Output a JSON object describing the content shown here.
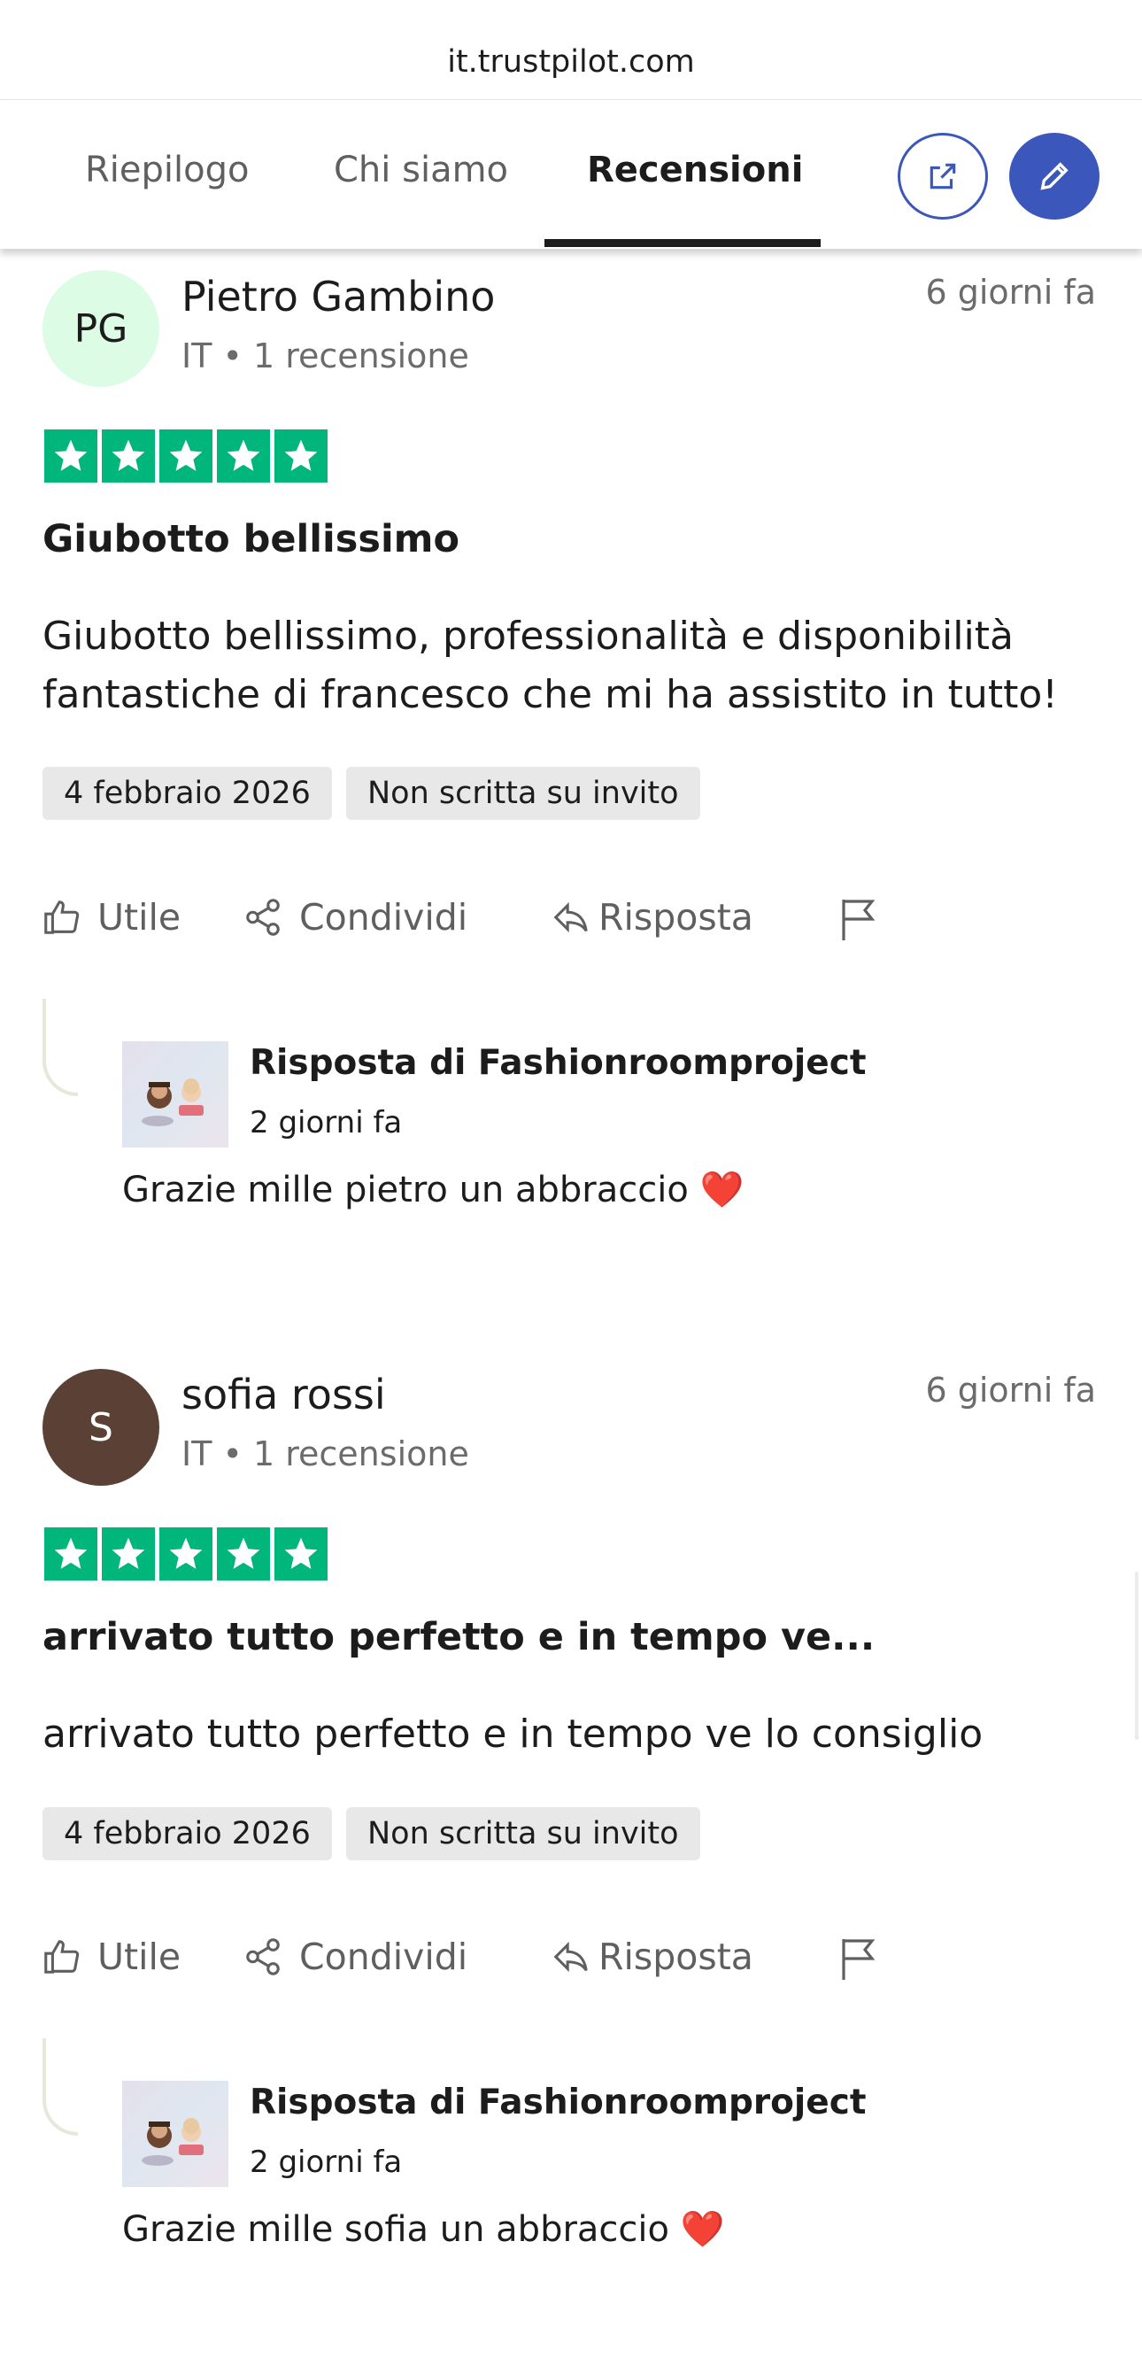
{
  "browser": {
    "url": "it.trustpilot.com"
  },
  "tabs": [
    {
      "label": "Riepilogo",
      "active": false
    },
    {
      "label": "Chi siamo",
      "active": false
    },
    {
      "label": "Recensioni",
      "active": true
    }
  ],
  "header_buttons": {
    "share_icon": "external-link-icon",
    "write_icon": "pencil-icon"
  },
  "colors": {
    "star_green": "#00b67a",
    "accent_blue": "#3c57bc",
    "avatar_pg_bg": "#dcfce5",
    "avatar_s_bg": "#5b4036"
  },
  "reviews": [
    {
      "initials": "PG",
      "name": "Pietro Gambino",
      "meta": "IT • 1 recensione",
      "date": "6 giorni fa",
      "rating": 5,
      "title": "Giubotto bellissimo",
      "text": "Giubotto bellissimo, professionalità e disponibilità fantastiche di francesco che mi ha assistito in tutto!",
      "experience_date": "4 febbraio 2026",
      "invite_badge": "Non scritta su invito",
      "actions": {
        "useful": "Utile",
        "share": "Condividi",
        "reply": "Risposta"
      },
      "reply": {
        "author": "Risposta di Fashionroomproject",
        "time": "2 giorni fa",
        "text": "Grazie mille pietro un abbraccio ❤️"
      }
    },
    {
      "initials": "S",
      "name": "sofia rossi",
      "meta": "IT • 1 recensione",
      "date": "6 giorni fa",
      "rating": 5,
      "title": "arrivato tutto perfetto e in tempo ve...",
      "text": "arrivato tutto perfetto e in tempo ve lo consiglio",
      "experience_date": "4 febbraio 2026",
      "invite_badge": "Non scritta su invito",
      "actions": {
        "useful": "Utile",
        "share": "Condividi",
        "reply": "Risposta"
      },
      "reply": {
        "author": "Risposta di Fashionroomproject",
        "time": "2 giorni fa",
        "text": "Grazie mille sofia un abbraccio ❤️"
      }
    }
  ]
}
